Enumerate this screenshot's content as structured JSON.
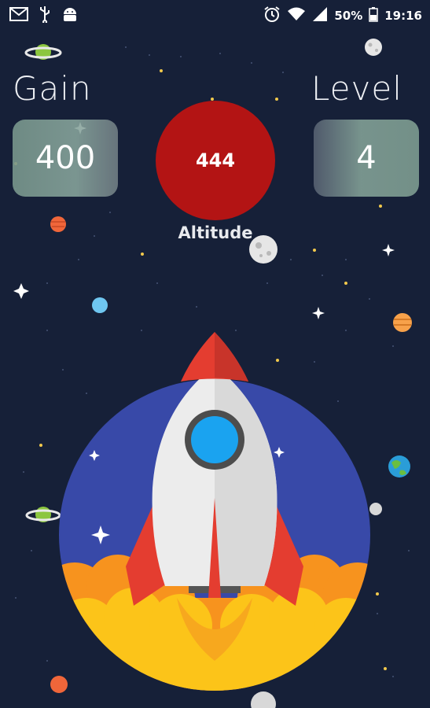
{
  "status_bar": {
    "left_icons": [
      "gmail-icon",
      "usb-icon",
      "android-debug-icon"
    ],
    "right_icons": [
      "alarm-icon",
      "wifi-icon",
      "signal-icon",
      "battery-icon"
    ],
    "battery": "50%",
    "time": "19:16"
  },
  "hud": {
    "gain_label": "Gain",
    "gain_value": "400",
    "altitude_value": "444",
    "altitude_label": "Altitude",
    "level_label": "Level",
    "level_value": "4"
  },
  "colors": {
    "background": "#162038",
    "altitude_circle": "#b31414",
    "launch_pad": "#3849a8",
    "rocket_body": "#ececec",
    "rocket_red": "#e43d30",
    "window": "#1aa3f0",
    "flame_orange": "#f7931e",
    "flame_yellow": "#fcc419"
  },
  "scene": {
    "rocket": "rocket-icon",
    "launch_pad": "launch-circle",
    "decorations": [
      "ringed-planet-icon",
      "planet-icon",
      "moon-icon",
      "earth-icon",
      "star-icon"
    ]
  }
}
